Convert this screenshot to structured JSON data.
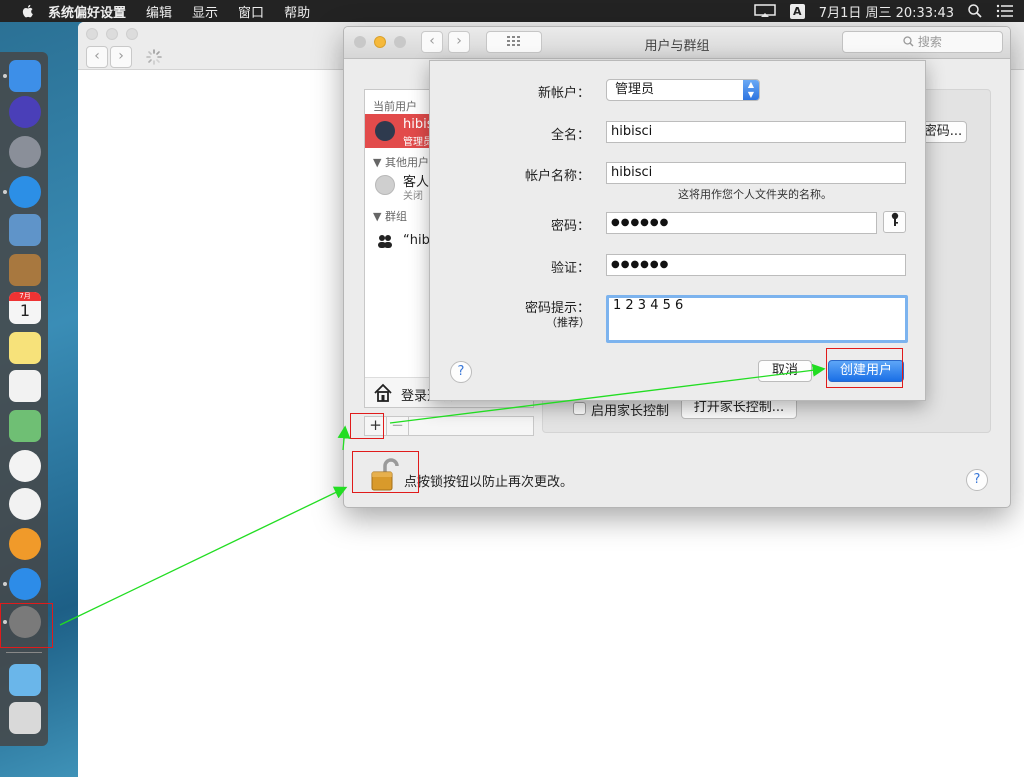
{
  "menubar": {
    "apple_icon": "apple-logo-icon",
    "items": [
      "系统偏好设置",
      "编辑",
      "显示",
      "窗口",
      "帮助"
    ],
    "ime": "A",
    "datetime": "7月1日 周三  20:33:43"
  },
  "dock": {
    "items": [
      {
        "name": "finder",
        "color": "#3d8fe8"
      },
      {
        "name": "siri",
        "color": "#4a3fb8"
      },
      {
        "name": "launchpad",
        "color": "#8a8f99"
      },
      {
        "name": "safari",
        "color": "#2c8fe6"
      },
      {
        "name": "mail",
        "color": "#5f94c9"
      },
      {
        "name": "contacts",
        "color": "#a8783f"
      },
      {
        "name": "calendar",
        "color": "#f5f5f5"
      },
      {
        "name": "notes",
        "color": "#f7e27a"
      },
      {
        "name": "reminders",
        "color": "#f2f2f2"
      },
      {
        "name": "maps",
        "color": "#6fbf74"
      },
      {
        "name": "photos",
        "color": "#f3f3f3"
      },
      {
        "name": "itunes",
        "color": "#f2f2f2"
      },
      {
        "name": "ibooks",
        "color": "#f09a2a"
      },
      {
        "name": "app-store",
        "color": "#2d8ce8"
      },
      {
        "name": "system-preferences",
        "color": "#7a7a7a"
      },
      {
        "name": "downloads-folder",
        "color": "#6ab6ea"
      },
      {
        "name": "trash",
        "color": "#d9d9d9"
      }
    ],
    "calendar_month": "7月",
    "calendar_day": "1"
  },
  "window": {
    "title": "用户与群组",
    "search_placeholder": "搜索"
  },
  "sidebar": {
    "current_user_header": "当前用户",
    "current_user_name": "hibisci",
    "current_user_role": "管理员",
    "other_users_header": "其他用户",
    "guest_name": "客人用户",
    "guest_status": "关闭",
    "groups_header": "群组",
    "group_name": "“hibisci”",
    "login_options": "登录选项"
  },
  "right_pane": {
    "change_password_button": "更改密码...",
    "parental_controls_checkbox": "启用家长控制",
    "open_parental_controls_button": "打开家长控制..."
  },
  "lock": {
    "text": "点按锁按钮以防止再次更改。"
  },
  "sheet": {
    "new_account_label": "新帐户：",
    "new_account_value": "管理员",
    "full_name_label": "全名：",
    "full_name_value": "hibisci",
    "account_name_label": "帐户名称：",
    "account_name_value": "hibisci",
    "account_name_hint": "这将用作您个人文件夹的名称。",
    "password_label": "密码：",
    "password_value": "●●●●●●",
    "verify_label": "验证：",
    "verify_value": "●●●●●●",
    "hint_label": "密码提示：",
    "hint_sub": "（推荐）",
    "hint_value": "1 2 3 4 5 6",
    "cancel_button": "取消",
    "create_button": "创建用户",
    "help": "?"
  },
  "colors": {
    "accent": "#1a6fe6",
    "selection": "#e24b4b",
    "annotation_box": "#e01b1b",
    "annotation_arrow": "#22dd22"
  }
}
